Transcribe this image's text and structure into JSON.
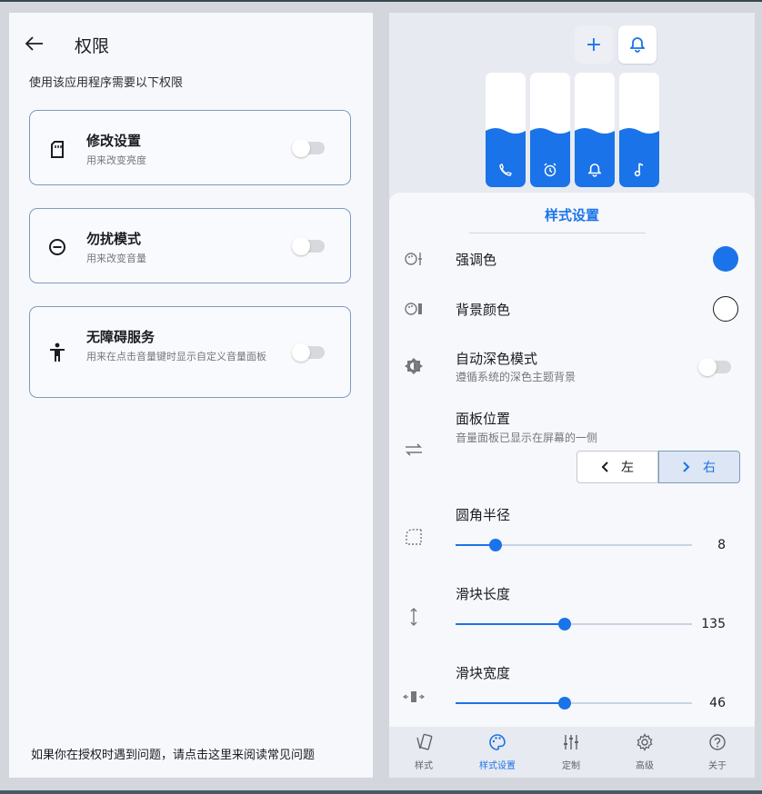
{
  "permissions": {
    "title": "权限",
    "subtitle": "使用该应用程序需要以下权限",
    "items": [
      {
        "title": "修改设置",
        "desc": "用来改变亮度",
        "icon": "sd-card-icon"
      },
      {
        "title": "勿扰模式",
        "desc": "用来改变音量",
        "icon": "minus-circle-icon"
      },
      {
        "title": "无障碍服务",
        "desc": "用来在点击音量键时显示自定义音量面板",
        "icon": "accessibility-icon"
      }
    ],
    "footer": "如果你在授权时遇到问题，请点击这里来阅读常见问题"
  },
  "preview": {
    "add_label": "+",
    "sliders": [
      {
        "icon": "phone-icon",
        "level": 0.45
      },
      {
        "icon": "alarm-icon",
        "level": 0.45
      },
      {
        "icon": "bell-icon",
        "level": 0.45
      },
      {
        "icon": "music-icon",
        "level": 0.45
      }
    ]
  },
  "style_settings": {
    "title": "样式设置",
    "accent_color": {
      "label": "强调色",
      "value": "#1a73e8"
    },
    "background_color": {
      "label": "背景颜色",
      "value": "#ffffff"
    },
    "dark_mode": {
      "label": "自动深色模式",
      "desc": "遵循系统的深色主题背景",
      "enabled": false
    },
    "panel_position": {
      "label": "面板位置",
      "desc": "音量面板已显示在屏幕的一侧",
      "left_label": "左",
      "right_label": "右",
      "selected": "right"
    },
    "corner_radius": {
      "label": "圆角半径",
      "value": "8",
      "fraction": 0.17
    },
    "slider_length": {
      "label": "滑块长度",
      "value": "135",
      "fraction": 0.46
    },
    "slider_width": {
      "label": "滑块宽度",
      "value": "46",
      "fraction": 0.46
    }
  },
  "nav": {
    "items": [
      {
        "label": "样式",
        "icon": "style-icon",
        "active": false
      },
      {
        "label": "样式设置",
        "icon": "palette-icon",
        "active": true
      },
      {
        "label": "定制",
        "icon": "tune-icon",
        "active": false
      },
      {
        "label": "高级",
        "icon": "gear-icon",
        "active": false
      },
      {
        "label": "关于",
        "icon": "help-icon",
        "active": false
      }
    ]
  },
  "colors": {
    "accent": "#1a73e8",
    "card_border": "#7d9bbd"
  }
}
